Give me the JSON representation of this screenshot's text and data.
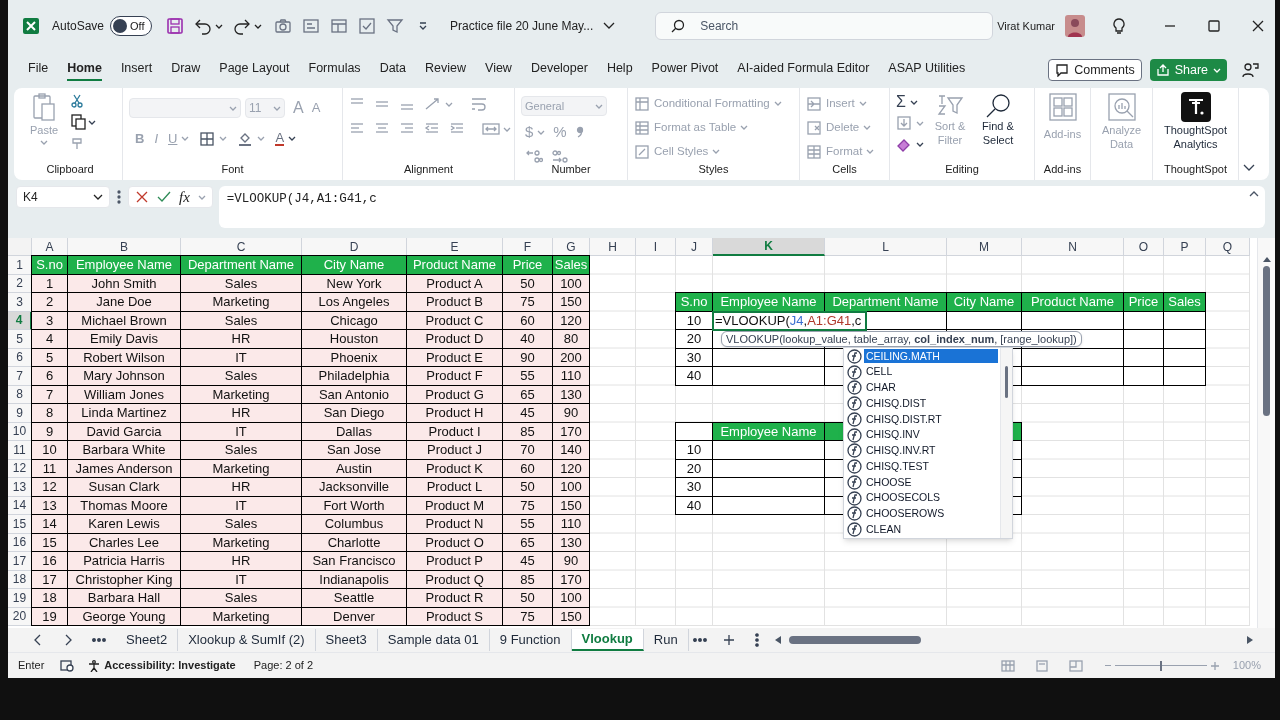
{
  "title_bar": {
    "autosave_label": "AutoSave",
    "autosave": {
      "on": false,
      "label": "Off"
    },
    "file_title": "Practice file 20 June May...",
    "search": {
      "placeholder": "Search"
    },
    "user_name": "Virat Kumar"
  },
  "ribbon_tabs": [
    {
      "label": "File",
      "selected": false
    },
    {
      "label": "Home",
      "selected": true
    },
    {
      "label": "Insert",
      "selected": false
    },
    {
      "label": "Draw",
      "selected": false
    },
    {
      "label": "Page Layout",
      "selected": false
    },
    {
      "label": "Formulas",
      "selected": false
    },
    {
      "label": "Data",
      "selected": false
    },
    {
      "label": "Review",
      "selected": false
    },
    {
      "label": "View",
      "selected": false
    },
    {
      "label": "Developer",
      "selected": false
    },
    {
      "label": "Help",
      "selected": false
    },
    {
      "label": "Power Pivot",
      "selected": false
    },
    {
      "label": "AI-aided Formula Editor",
      "selected": false
    },
    {
      "label": "ASAP Utilities",
      "selected": false
    }
  ],
  "comments_button": "Comments",
  "share_button": "Share",
  "ribbon": [
    {
      "kind": "clipboard",
      "label": "Clipboard",
      "paste": {
        "label": "Paste",
        "disabled": true
      }
    },
    {
      "kind": "font",
      "label": "Font",
      "size": "11",
      "grow": "A",
      "shrink": "A",
      "bold": "B",
      "italic": "I",
      "underline": "U",
      "font_color": "A"
    },
    {
      "kind": "alignment",
      "label": "Alignment"
    },
    {
      "kind": "number",
      "label": "Number",
      "format": "General",
      "currency": "$",
      "percent": "%"
    },
    {
      "kind": "styles",
      "label": "Styles",
      "items": [
        {
          "label": "Conditional Formatting",
          "disabled": true
        },
        {
          "label": "Format as Table",
          "disabled": true
        },
        {
          "label": "Cell Styles",
          "disabled": true
        }
      ]
    },
    {
      "kind": "cells",
      "label": "Cells",
      "items": [
        {
          "label": "Insert",
          "disabled": true
        },
        {
          "label": "Delete",
          "disabled": true
        },
        {
          "label": "Format",
          "disabled": true
        }
      ]
    },
    {
      "kind": "editing",
      "label": "Editing",
      "sum": "Σ",
      "sort": {
        "label": "Sort & Filter",
        "disabled": true
      },
      "find": {
        "label": "Find & Select",
        "disabled": false
      }
    },
    {
      "kind": "addins",
      "label": "Add-ins",
      "button": {
        "label": "Add-ins",
        "disabled": true
      }
    },
    {
      "kind": "analyze",
      "button": {
        "label": "Analyze Data",
        "disabled": true
      }
    },
    {
      "kind": "thoughtspot",
      "label": "ThoughtSpot",
      "button": {
        "label": "ThoughtSpot Analytics",
        "disabled": false
      }
    }
  ],
  "formula_bar": {
    "name_box": "K4",
    "fx": "fx",
    "formula": "=VLOOKUP(J4,A1:G41,c"
  },
  "sheet": {
    "columns": [
      {
        "letter": "A",
        "selected": false
      },
      {
        "letter": "B",
        "selected": false
      },
      {
        "letter": "C",
        "selected": false
      },
      {
        "letter": "D",
        "selected": false
      },
      {
        "letter": "E",
        "selected": false
      },
      {
        "letter": "F",
        "selected": false
      },
      {
        "letter": "G",
        "selected": false
      },
      {
        "letter": "H",
        "selected": false
      },
      {
        "letter": "I",
        "selected": false
      },
      {
        "letter": "J",
        "selected": false
      },
      {
        "letter": "K",
        "selected": true
      },
      {
        "letter": "L",
        "selected": false
      },
      {
        "letter": "M",
        "selected": false
      },
      {
        "letter": "N",
        "selected": false
      },
      {
        "letter": "O",
        "selected": false
      },
      {
        "letter": "P",
        "selected": false
      },
      {
        "letter": "Q",
        "selected": false
      }
    ],
    "rows": [
      {
        "label": "1",
        "selected": false,
        "cells": [
          {
            "kind": "title",
            "text": "S.no"
          },
          {
            "kind": "title",
            "text": "Employee Name"
          },
          {
            "kind": "title",
            "text": "Department Name"
          },
          {
            "kind": "title",
            "text": "City Name"
          },
          {
            "kind": "title",
            "text": "Product Name"
          },
          {
            "kind": "title",
            "text": "Price"
          },
          {
            "kind": "title",
            "text": "Sales"
          }
        ]
      },
      {
        "label": "2",
        "selected": false,
        "cells": [
          {
            "kind": "source",
            "text": "1"
          },
          {
            "kind": "source",
            "text": "John Smith"
          },
          {
            "kind": "source",
            "text": "Sales"
          },
          {
            "kind": "source",
            "text": "New York"
          },
          {
            "kind": "source",
            "text": "Product A"
          },
          {
            "kind": "source",
            "text": "50"
          },
          {
            "kind": "source",
            "text": "100"
          }
        ]
      },
      {
        "label": "3",
        "selected": false,
        "cells": [
          {
            "kind": "source",
            "text": "2"
          },
          {
            "kind": "source",
            "text": "Jane Doe"
          },
          {
            "kind": "source",
            "text": "Marketing"
          },
          {
            "kind": "source",
            "text": "Los Angeles"
          },
          {
            "kind": "source",
            "text": "Product B"
          },
          {
            "kind": "source",
            "text": "75"
          },
          {
            "kind": "source",
            "text": "150"
          },
          "",
          "",
          {
            "kind": "title",
            "text": "S.no"
          },
          {
            "kind": "title",
            "text": "Employee Name"
          },
          {
            "kind": "title",
            "text": "Department Name"
          },
          {
            "kind": "title",
            "text": "City Name"
          },
          {
            "kind": "title",
            "text": "Product Name"
          },
          {
            "kind": "title",
            "text": "Price"
          },
          {
            "kind": "title",
            "text": "Sales"
          }
        ]
      },
      {
        "label": "4",
        "selected": true,
        "cells": [
          {
            "kind": "source",
            "text": "3"
          },
          {
            "kind": "source",
            "text": "Michael Brown"
          },
          {
            "kind": "source",
            "text": "Sales"
          },
          {
            "kind": "source",
            "text": "Chicago"
          },
          {
            "kind": "source",
            "text": "Product C"
          },
          {
            "kind": "source",
            "text": "60"
          },
          {
            "kind": "source",
            "text": "120"
          },
          "",
          "",
          {
            "kind": "entry",
            "text": "10"
          },
          {
            "kind": "edit",
            "parts": [
              {
                "text": "=VLOOKUP("
              },
              {
                "text": "J4",
                "color": "#3b6fd1"
              },
              {
                "text": ","
              },
              {
                "text": "A1:G41",
                "color": "#b0392c"
              },
              {
                "text": ",c"
              }
            ]
          },
          {
            "kind": "entry"
          },
          {
            "kind": "entry"
          },
          {
            "kind": "entry"
          },
          {
            "kind": "entry"
          },
          {
            "kind": "entry"
          }
        ]
      },
      {
        "label": "5",
        "selected": false,
        "cells": [
          {
            "kind": "source",
            "text": "4"
          },
          {
            "kind": "source",
            "text": "Emily Davis"
          },
          {
            "kind": "source",
            "text": "HR"
          },
          {
            "kind": "source",
            "text": "Houston"
          },
          {
            "kind": "source",
            "text": "Product D"
          },
          {
            "kind": "source",
            "text": "40"
          },
          {
            "kind": "source",
            "text": "80"
          },
          "",
          "",
          {
            "kind": "entry",
            "text": "20"
          },
          {
            "kind": "entry"
          },
          {
            "kind": "entry"
          },
          {
            "kind": "entry"
          },
          {
            "kind": "entry"
          },
          {
            "kind": "entry"
          },
          {
            "kind": "entry"
          }
        ]
      },
      {
        "label": "6",
        "selected": false,
        "cells": [
          {
            "kind": "source",
            "text": "5"
          },
          {
            "kind": "source",
            "text": "Robert Wilson"
          },
          {
            "kind": "source",
            "text": "IT"
          },
          {
            "kind": "source",
            "text": "Phoenix"
          },
          {
            "kind": "source",
            "text": "Product E"
          },
          {
            "kind": "source",
            "text": "90"
          },
          {
            "kind": "source",
            "text": "200"
          },
          "",
          "",
          {
            "kind": "entry",
            "text": "30"
          },
          {
            "kind": "entry"
          },
          {
            "kind": "entry"
          },
          {
            "kind": "entry"
          },
          {
            "kind": "entry"
          },
          {
            "kind": "entry"
          },
          {
            "kind": "entry"
          }
        ]
      },
      {
        "label": "7",
        "selected": false,
        "cells": [
          {
            "kind": "source",
            "text": "6"
          },
          {
            "kind": "source",
            "text": "Mary Johnson"
          },
          {
            "kind": "source",
            "text": "Sales"
          },
          {
            "kind": "source",
            "text": "Philadelphia"
          },
          {
            "kind": "source",
            "text": "Product F"
          },
          {
            "kind": "source",
            "text": "55"
          },
          {
            "kind": "source",
            "text": "110"
          },
          "",
          "",
          {
            "kind": "entry",
            "text": "40"
          },
          {
            "kind": "entry"
          },
          {
            "kind": "entry"
          },
          {
            "kind": "entry"
          },
          {
            "kind": "entry"
          },
          {
            "kind": "entry"
          },
          {
            "kind": "entry"
          }
        ]
      },
      {
        "label": "8",
        "selected": false,
        "cells": [
          {
            "kind": "source",
            "text": "7"
          },
          {
            "kind": "source",
            "text": "William Jones"
          },
          {
            "kind": "source",
            "text": "Marketing"
          },
          {
            "kind": "source",
            "text": "San Antonio"
          },
          {
            "kind": "source",
            "text": "Product G"
          },
          {
            "kind": "source",
            "text": "65"
          },
          {
            "kind": "source",
            "text": "130"
          }
        ]
      },
      {
        "label": "9",
        "selected": false,
        "cells": [
          {
            "kind": "source",
            "text": "8"
          },
          {
            "kind": "source",
            "text": "Linda Martinez"
          },
          {
            "kind": "source",
            "text": "HR"
          },
          {
            "kind": "source",
            "text": "San Diego"
          },
          {
            "kind": "source",
            "text": "Product H"
          },
          {
            "kind": "source",
            "text": "45"
          },
          {
            "kind": "source",
            "text": "90"
          }
        ]
      },
      {
        "label": "10",
        "selected": false,
        "cells": [
          {
            "kind": "source",
            "text": "9"
          },
          {
            "kind": "source",
            "text": "David Garcia"
          },
          {
            "kind": "source",
            "text": "IT"
          },
          {
            "kind": "source",
            "text": "Dallas"
          },
          {
            "kind": "source",
            "text": "Product I"
          },
          {
            "kind": "source",
            "text": "85"
          },
          {
            "kind": "source",
            "text": "170"
          },
          "",
          "",
          {
            "kind": "entry"
          },
          {
            "kind": "title",
            "text": "Employee Name"
          },
          {
            "kind": "title"
          },
          {
            "kind": "title"
          }
        ]
      },
      {
        "label": "11",
        "selected": false,
        "cells": [
          {
            "kind": "source",
            "text": "10"
          },
          {
            "kind": "source",
            "text": "Barbara White"
          },
          {
            "kind": "source",
            "text": "Sales"
          },
          {
            "kind": "source",
            "text": "San Jose"
          },
          {
            "kind": "source",
            "text": "Product J"
          },
          {
            "kind": "source",
            "text": "70"
          },
          {
            "kind": "source",
            "text": "140"
          },
          "",
          "",
          {
            "kind": "entry",
            "text": "10"
          },
          {
            "kind": "entry"
          },
          {
            "kind": "entry"
          },
          {
            "kind": "entry"
          }
        ]
      },
      {
        "label": "12",
        "selected": false,
        "cells": [
          {
            "kind": "source",
            "text": "11"
          },
          {
            "kind": "source",
            "text": "James Anderson"
          },
          {
            "kind": "source",
            "text": "Marketing"
          },
          {
            "kind": "source",
            "text": "Austin"
          },
          {
            "kind": "source",
            "text": "Product K"
          },
          {
            "kind": "source",
            "text": "60"
          },
          {
            "kind": "source",
            "text": "120"
          },
          "",
          "",
          {
            "kind": "entry",
            "text": "20"
          },
          {
            "kind": "entry"
          },
          {
            "kind": "entry"
          },
          {
            "kind": "entry"
          }
        ]
      },
      {
        "label": "13",
        "selected": false,
        "cells": [
          {
            "kind": "source",
            "text": "12"
          },
          {
            "kind": "source",
            "text": "Susan Clark"
          },
          {
            "kind": "source",
            "text": "HR"
          },
          {
            "kind": "source",
            "text": "Jacksonville"
          },
          {
            "kind": "source",
            "text": "Product L"
          },
          {
            "kind": "source",
            "text": "50"
          },
          {
            "kind": "source",
            "text": "100"
          },
          "",
          "",
          {
            "kind": "entry",
            "text": "30"
          },
          {
            "kind": "entry"
          },
          {
            "kind": "entry"
          },
          {
            "kind": "entry"
          }
        ]
      },
      {
        "label": "14",
        "selected": false,
        "cells": [
          {
            "kind": "source",
            "text": "13"
          },
          {
            "kind": "source",
            "text": "Thomas Moore"
          },
          {
            "kind": "source",
            "text": "IT"
          },
          {
            "kind": "source",
            "text": "Fort Worth"
          },
          {
            "kind": "source",
            "text": "Product M"
          },
          {
            "kind": "source",
            "text": "75"
          },
          {
            "kind": "source",
            "text": "150"
          },
          "",
          "",
          {
            "kind": "entry",
            "text": "40"
          },
          {
            "kind": "entry"
          },
          {
            "kind": "entry"
          },
          {
            "kind": "entry"
          }
        ]
      },
      {
        "label": "15",
        "selected": false,
        "cells": [
          {
            "kind": "source",
            "text": "14"
          },
          {
            "kind": "source",
            "text": "Karen Lewis"
          },
          {
            "kind": "source",
            "text": "Sales"
          },
          {
            "kind": "source",
            "text": "Columbus"
          },
          {
            "kind": "source",
            "text": "Product N"
          },
          {
            "kind": "source",
            "text": "55"
          },
          {
            "kind": "source",
            "text": "110"
          }
        ]
      },
      {
        "label": "16",
        "selected": false,
        "cells": [
          {
            "kind": "source",
            "text": "15"
          },
          {
            "kind": "source",
            "text": "Charles Lee"
          },
          {
            "kind": "source",
            "text": "Marketing"
          },
          {
            "kind": "source",
            "text": "Charlotte"
          },
          {
            "kind": "source",
            "text": "Product O"
          },
          {
            "kind": "source",
            "text": "65"
          },
          {
            "kind": "source",
            "text": "130"
          }
        ]
      },
      {
        "label": "17",
        "selected": false,
        "cells": [
          {
            "kind": "source",
            "text": "16"
          },
          {
            "kind": "source",
            "text": "Patricia Harris"
          },
          {
            "kind": "source",
            "text": "HR"
          },
          {
            "kind": "source",
            "text": "San Francisco"
          },
          {
            "kind": "source",
            "text": "Product P"
          },
          {
            "kind": "source",
            "text": "45"
          },
          {
            "kind": "source",
            "text": "90"
          }
        ]
      },
      {
        "label": "18",
        "selected": false,
        "cells": [
          {
            "kind": "source",
            "text": "17"
          },
          {
            "kind": "source",
            "text": "Christopher King"
          },
          {
            "kind": "source",
            "text": "IT"
          },
          {
            "kind": "source",
            "text": "Indianapolis"
          },
          {
            "kind": "source",
            "text": "Product Q"
          },
          {
            "kind": "source",
            "text": "85"
          },
          {
            "kind": "source",
            "text": "170"
          }
        ]
      },
      {
        "label": "19",
        "selected": false,
        "cells": [
          {
            "kind": "source",
            "text": "18"
          },
          {
            "kind": "source",
            "text": "Barbara Hall"
          },
          {
            "kind": "source",
            "text": "Sales"
          },
          {
            "kind": "source",
            "text": "Seattle"
          },
          {
            "kind": "source",
            "text": "Product R"
          },
          {
            "kind": "source",
            "text": "50"
          },
          {
            "kind": "source",
            "text": "100"
          }
        ]
      },
      {
        "label": "20",
        "selected": false,
        "cells": [
          {
            "kind": "source",
            "text": "19"
          },
          {
            "kind": "source",
            "text": "George Young"
          },
          {
            "kind": "source",
            "text": "Marketing"
          },
          {
            "kind": "source",
            "text": "Denver"
          },
          {
            "kind": "source",
            "text": "Product S"
          },
          {
            "kind": "source",
            "text": "75"
          },
          {
            "kind": "source",
            "text": "150"
          }
        ]
      }
    ],
    "tooltip": {
      "text": "VLOOKUP(lookup_value, table_array, **col_index_num**, [range_lookup])"
    },
    "autocomplete": [
      {
        "label": "CEILING.MATH",
        "selected": true
      },
      {
        "label": "CELL",
        "selected": false
      },
      {
        "label": "CHAR",
        "selected": false
      },
      {
        "label": "CHISQ.DIST",
        "selected": false
      },
      {
        "label": "CHISQ.DIST.RT",
        "selected": false
      },
      {
        "label": "CHISQ.INV",
        "selected": false
      },
      {
        "label": "CHISQ.INV.RT",
        "selected": false
      },
      {
        "label": "CHISQ.TEST",
        "selected": false
      },
      {
        "label": "CHOOSE",
        "selected": false
      },
      {
        "label": "CHOOSECOLS",
        "selected": false
      },
      {
        "label": "CHOOSEROWS",
        "selected": false
      },
      {
        "label": "CLEAN",
        "selected": false
      }
    ]
  },
  "sheet_tabs": [
    {
      "label": "Sheet2",
      "selected": false
    },
    {
      "label": "Xlookup & SumIf (2)",
      "selected": false
    },
    {
      "label": "Sheet3",
      "selected": false
    },
    {
      "label": "Sample data 01",
      "selected": false
    },
    {
      "label": "9 Function",
      "selected": false
    },
    {
      "label": "Vlookup",
      "selected": true
    },
    {
      "label": "Run",
      "selected": false
    }
  ],
  "status_bar": {
    "mode": "Enter",
    "accessibility": "Accessibility: Investigate",
    "page": "Page: 2 of 2",
    "zoom": "100%",
    "zoom_slider": {
      "level": 0.5
    }
  }
}
